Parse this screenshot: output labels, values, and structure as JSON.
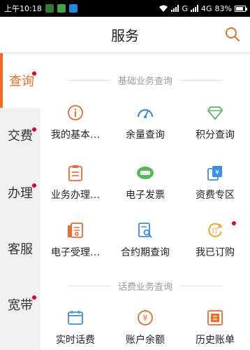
{
  "status_bar": {
    "time": "上午10:18",
    "network": "G",
    "network2": "4G",
    "battery_level": "83%",
    "battery_fraction": 0.83
  },
  "header": {
    "title": "服务",
    "search_icon": "search-icon"
  },
  "sidenav": {
    "items": [
      {
        "label": "查询",
        "active": true,
        "dot": true
      },
      {
        "label": "交费",
        "active": false,
        "dot": true
      },
      {
        "label": "办理",
        "active": false,
        "dot": true
      },
      {
        "label": "客服",
        "active": false,
        "dot": false
      },
      {
        "label": "宽带",
        "active": false,
        "dot": true
      }
    ]
  },
  "sections": [
    {
      "title": "基础业务查询",
      "items": [
        {
          "label": "我的基本…",
          "icon": "info-icon"
        },
        {
          "label": "余量查询",
          "icon": "gauge-icon"
        },
        {
          "label": "积分查询",
          "icon": "diamond-icon"
        },
        {
          "label": "业务办理…",
          "icon": "clipboard-icon"
        },
        {
          "label": "电子发票",
          "icon": "invoice-icon"
        },
        {
          "label": "资费专区",
          "icon": "yen-cards-icon"
        },
        {
          "label": "电子受理…",
          "icon": "document-icon"
        },
        {
          "label": "合约期查询",
          "icon": "search-doc-icon"
        },
        {
          "label": "我已订购",
          "icon": "order-refresh-icon",
          "dot": true
        }
      ]
    },
    {
      "title": "话费业务查询",
      "items": [
        {
          "label": "实时话费",
          "icon": "calendar-icon"
        },
        {
          "label": "账户余额",
          "icon": "yen-coin-icon"
        },
        {
          "label": "历史账单",
          "icon": "bill-icon"
        }
      ]
    }
  ],
  "colors": {
    "accent": "#f26a2a",
    "blue": "#3a8ee6",
    "green": "#5cb85c",
    "dot": "#e4002b"
  }
}
